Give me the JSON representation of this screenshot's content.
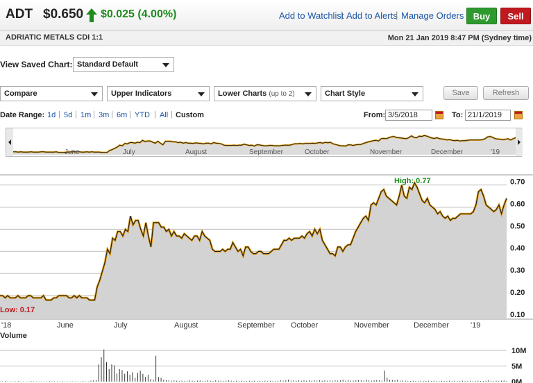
{
  "header": {
    "ticker": "ADT",
    "price": "$0.650",
    "change": "$0.025 (4.00%)",
    "links": [
      "Add to Watchlist",
      "Add to Alerts",
      "Manage Orders"
    ],
    "buy_label": "Buy",
    "sell_label": "Sell",
    "colors": {
      "up": "#1e8c1e",
      "buy": "#2e9a2e",
      "sell": "#c0191f",
      "link": "#1a56a8"
    }
  },
  "subheader": {
    "company": "ADRIATIC METALS CDI 1:1",
    "datetime": "Mon 21 Jan 2019 8:47 PM (Sydney time)"
  },
  "saved_chart": {
    "label": "View Saved Chart:",
    "value": "Standard Default"
  },
  "toolbar": {
    "compare": "Compare",
    "upper_indicators": "Upper Indicators",
    "lower_charts": "Lower Charts",
    "lower_charts_note": "(up to 2)",
    "chart_style": "Chart Style",
    "save_label": "Save",
    "refresh_label": "Refresh"
  },
  "date_range": {
    "label": "Date Range:",
    "options": [
      "1d",
      "5d",
      "1m",
      "3m",
      "6m",
      "YTD",
      "All"
    ],
    "custom": "Custom",
    "from_label": "From:",
    "from_value": "3/5/2018",
    "to_label": "To:",
    "to_value": "21/1/2019"
  },
  "navigator": {
    "months": [
      "June",
      "July",
      "August",
      "September",
      "October",
      "November",
      "December",
      "'19"
    ]
  },
  "chart_data": {
    "type": "area",
    "x_labels": [
      "'18",
      "June",
      "July",
      "August",
      "September",
      "October",
      "November",
      "December",
      "'19"
    ],
    "y_ticks": [
      0.7,
      0.6,
      0.5,
      0.4,
      0.3,
      0.2,
      0.1
    ],
    "ylim": [
      0.09,
      0.73
    ],
    "high_label": "High: 0.77",
    "low_label": "Low: 0.17",
    "series": [
      {
        "values": [
          0.19,
          0.19,
          0.18,
          0.19,
          0.18,
          0.18,
          0.18,
          0.19,
          0.18,
          0.18,
          0.18,
          0.19,
          0.19,
          0.18,
          0.18,
          0.18,
          0.18,
          0.19,
          0.17,
          0.17,
          0.17,
          0.18,
          0.18,
          0.19,
          0.19,
          0.19,
          0.19,
          0.18,
          0.18,
          0.19,
          0.18,
          0.19,
          0.18,
          0.18,
          0.18,
          0.17,
          0.17,
          0.17,
          0.23,
          0.26,
          0.3,
          0.34,
          0.4,
          0.38,
          0.45,
          0.44,
          0.48,
          0.48,
          0.46,
          0.49,
          0.48,
          0.55,
          0.51,
          0.53,
          0.53,
          0.49,
          0.46,
          0.52,
          0.46,
          0.41,
          0.52,
          0.52,
          0.52,
          0.5,
          0.5,
          0.48,
          0.49,
          0.46,
          0.48,
          0.46,
          0.46,
          0.45,
          0.47,
          0.46,
          0.45,
          0.44,
          0.46,
          0.46,
          0.44,
          0.48,
          0.46,
          0.45,
          0.44,
          0.4,
          0.39,
          0.39,
          0.39,
          0.4,
          0.39,
          0.4,
          0.4,
          0.43,
          0.41,
          0.39,
          0.4,
          0.37,
          0.41,
          0.41,
          0.39,
          0.38,
          0.38,
          0.39,
          0.39,
          0.38,
          0.38,
          0.38,
          0.39,
          0.4,
          0.4,
          0.4,
          0.42,
          0.44,
          0.44,
          0.45,
          0.44,
          0.45,
          0.45,
          0.45,
          0.46,
          0.45,
          0.47,
          0.48,
          0.46,
          0.49,
          0.47,
          0.49,
          0.44,
          0.42,
          0.4,
          0.38,
          0.38,
          0.37,
          0.41,
          0.41,
          0.39,
          0.41,
          0.42,
          0.42,
          0.45,
          0.48,
          0.5,
          0.52,
          0.54,
          0.55,
          0.53,
          0.6,
          0.61,
          0.6,
          0.63,
          0.66,
          0.67,
          0.64,
          0.63,
          0.62,
          0.61,
          0.6,
          0.64,
          0.69,
          0.64,
          0.63,
          0.68,
          0.67,
          0.7,
          0.68,
          0.65,
          0.62,
          0.61,
          0.63,
          0.6,
          0.59,
          0.58,
          0.56,
          0.57,
          0.55,
          0.54,
          0.55,
          0.53,
          0.54,
          0.54,
          0.55,
          0.56,
          0.56,
          0.56,
          0.56,
          0.56,
          0.57,
          0.6,
          0.66,
          0.67,
          0.64,
          0.6,
          0.59,
          0.58,
          0.57,
          0.58,
          0.6,
          0.56,
          0.6,
          0.63
        ]
      }
    ]
  },
  "volume": {
    "label": "Volume",
    "ticks": [
      "10M",
      "5M",
      "0M"
    ],
    "ymax": 12,
    "values_m": [
      0.1,
      0.1,
      0.2,
      0.1,
      0.1,
      0.1,
      0.1,
      0.2,
      0.1,
      0.1,
      0.1,
      0.1,
      0.2,
      0.1,
      0.1,
      0.1,
      0.1,
      0.1,
      0.1,
      0.2,
      0.1,
      0.1,
      0.1,
      0.1,
      0.2,
      0.1,
      0.1,
      0.1,
      0.1,
      0.1,
      0.1,
      0.1,
      0.2,
      0.1,
      0.1,
      0.3,
      0.4,
      0.5,
      5.5,
      7.8,
      10.3,
      6.2,
      4.0,
      5.5,
      5.2,
      2.6,
      4.0,
      3.7,
      2.5,
      3.3,
      2.2,
      3.0,
      1.2,
      2.8,
      3.5,
      2.5,
      1.5,
      2.2,
      0.8,
      0.6,
      8.3,
      1.5,
      1.2,
      0.6,
      0.5,
      0.4,
      0.3,
      0.4,
      0.3,
      0.2,
      0.3,
      0.2,
      0.3,
      0.4,
      0.3,
      0.2,
      0.3,
      0.4,
      0.2,
      0.3,
      0.4,
      0.3,
      0.2,
      0.4,
      0.3,
      0.3,
      0.2,
      0.3,
      0.4,
      0.3,
      0.2,
      0.3,
      0.2,
      0.3,
      0.2,
      0.2,
      0.3,
      0.2,
      0.3,
      0.2,
      0.3,
      0.2,
      0.3,
      0.2,
      0.3,
      0.2,
      0.2,
      0.3,
      0.4,
      0.3,
      0.4,
      0.6,
      0.3,
      0.4,
      0.3,
      0.4,
      0.3,
      0.4,
      0.3,
      0.4,
      0.3,
      0.4,
      0.3,
      0.4,
      0.3,
      0.4,
      0.3,
      0.4,
      0.3,
      0.4,
      0.3,
      0.4,
      0.6,
      0.3,
      0.5,
      0.3,
      0.3,
      0.4,
      0.5,
      0.4,
      0.3,
      0.6,
      0.4,
      0.3,
      0.4,
      0.5,
      0.4,
      0.3,
      3.5,
      1.2,
      0.6,
      0.5,
      0.4,
      0.6,
      0.3,
      0.4,
      0.3,
      0.2,
      0.2,
      0.3,
      0.2,
      0.2,
      0.3,
      0.2,
      0.2,
      0.3,
      0.2,
      0.3,
      0.2,
      0.2,
      0.3,
      0.2,
      0.2,
      0.3,
      0.2,
      0.3,
      0.2,
      0.2,
      0.3,
      0.2,
      0.2,
      0.3,
      0.2,
      0.2,
      0.3,
      0.2,
      0.2,
      0.3,
      0.4,
      0.3,
      0.2,
      0.3,
      0.2,
      0.3,
      0.4,
      0.2
    ]
  }
}
